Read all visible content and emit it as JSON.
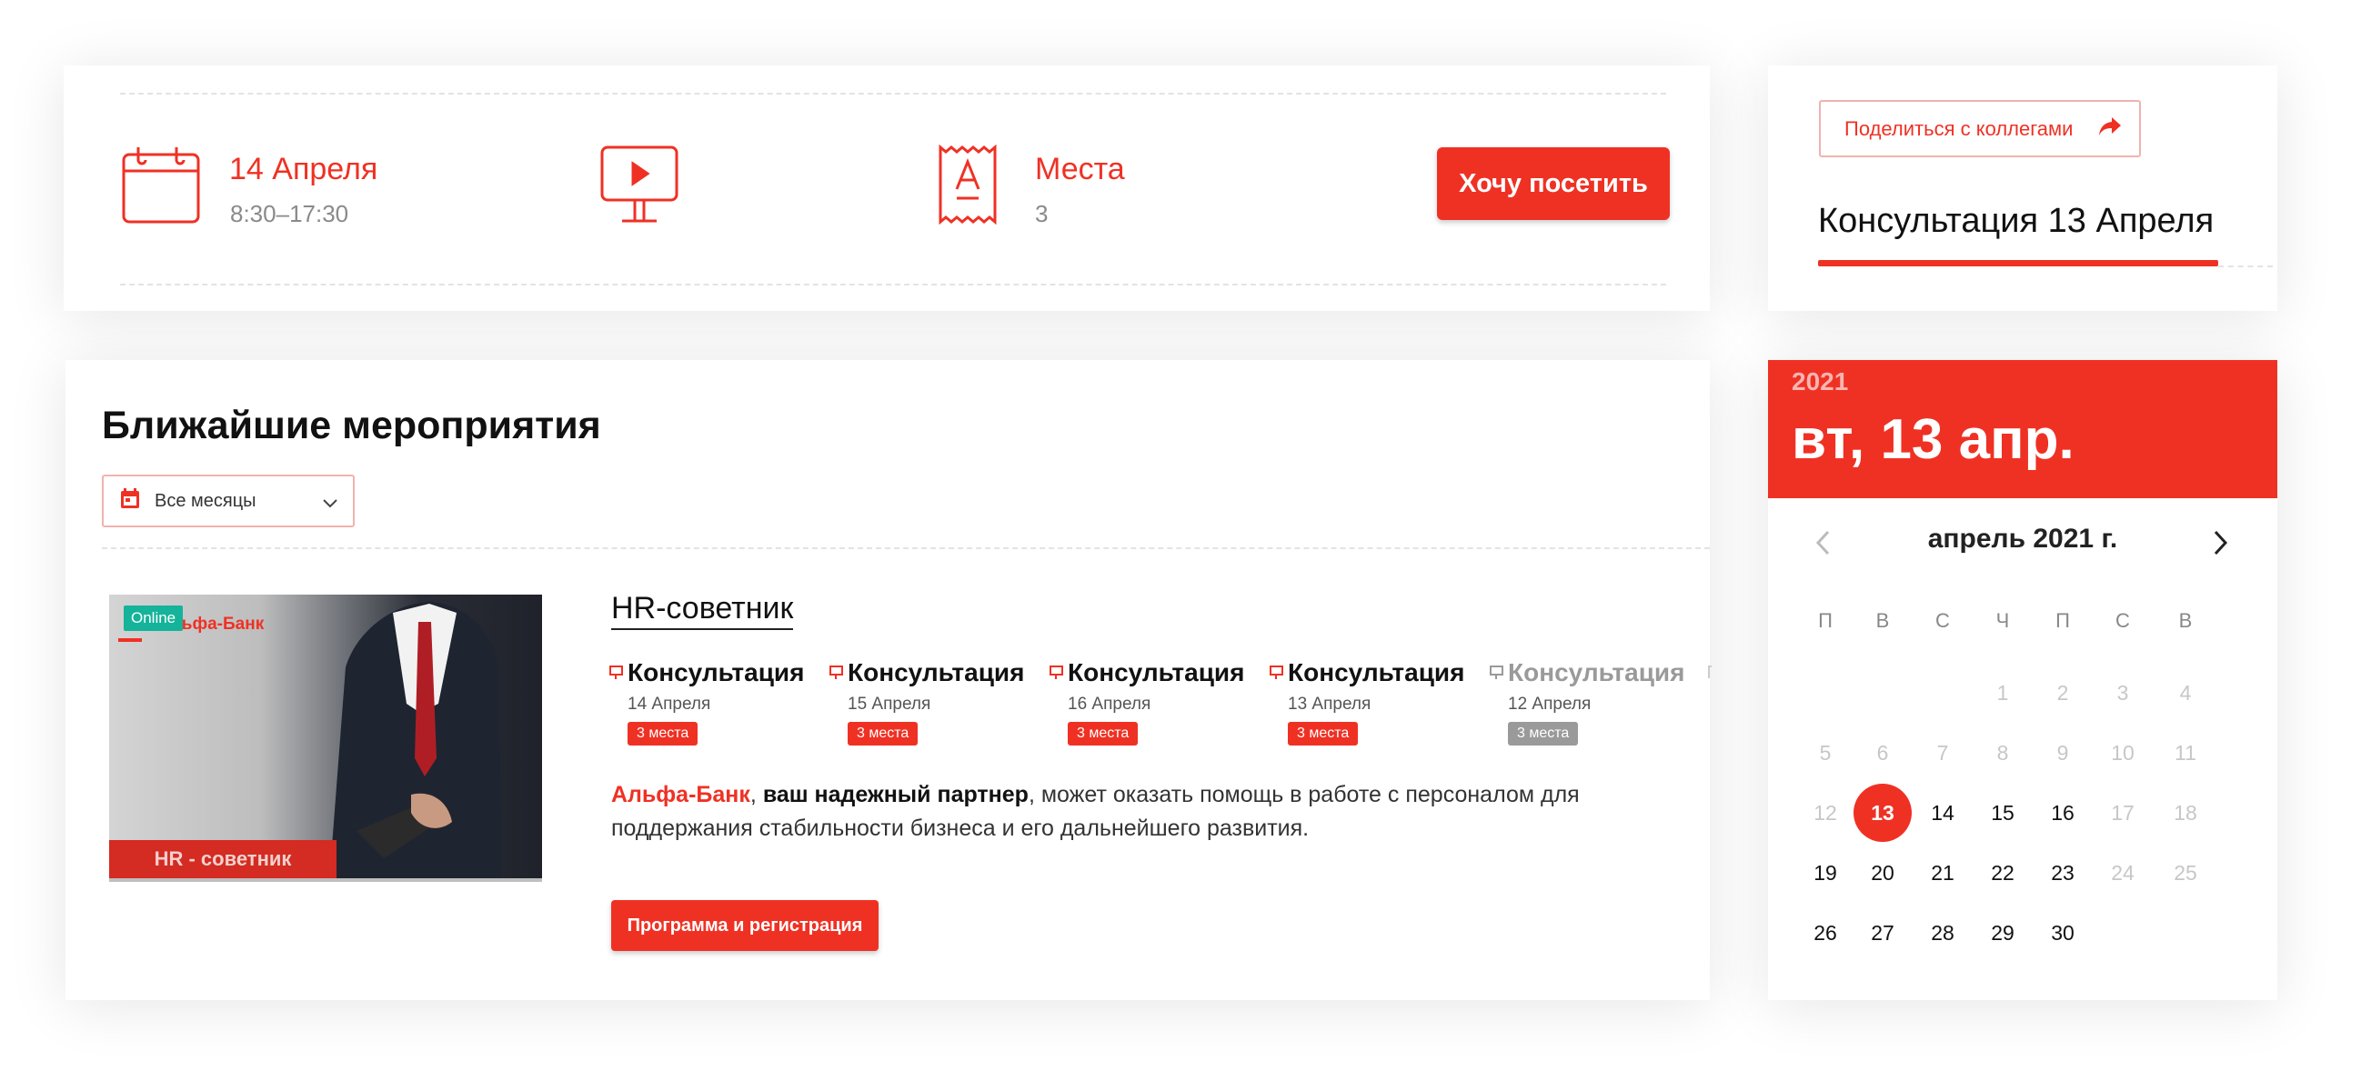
{
  "event_info": {
    "date_title": "14 Апреля",
    "time": "8:30–17:30",
    "seats_title": "Места",
    "seats_value": "3",
    "visit_button": "Хочу посетить"
  },
  "side": {
    "share_label": "Поделиться с коллегами",
    "title": "Консультация 13 Апреля"
  },
  "events": {
    "title": "Ближайшие мероприятия",
    "month_filter": "Все месяцы",
    "image": {
      "badge": "Online",
      "logo": "Альфа-Банк",
      "banner": "HR - советник"
    },
    "event_name": "HR-советник",
    "consultations": [
      {
        "title": "Консультация",
        "date": "14 Апреля",
        "badge": "3 места"
      },
      {
        "title": "Консультация",
        "date": "15 Апреля",
        "badge": "3 места"
      },
      {
        "title": "Консультация",
        "date": "16 Апреля",
        "badge": "3 места"
      },
      {
        "title": "Консультация",
        "date": "13 Апреля",
        "badge": "3 места"
      },
      {
        "title": "Консультация",
        "date": "12 Апреля",
        "badge": "3 места"
      }
    ],
    "description": {
      "brand": "Альфа-Банк",
      "comma": ", ",
      "bold": "ваш надежный партнер",
      "rest": ", может оказать помощь в работе с персоналом для поддержания стабильности бизнеса и его дальнейшего развития."
    },
    "register_button": "Программа и регистрация"
  },
  "calendar": {
    "year": "2021",
    "selected_date": "вт, 13 апр.",
    "month_label": "апрель 2021 г.",
    "weekdays": [
      "П",
      "В",
      "С",
      "Ч",
      "П",
      "С",
      "В"
    ],
    "weeks": [
      [
        "",
        "",
        "",
        "1",
        "2",
        "3",
        "4"
      ],
      [
        "5",
        "6",
        "7",
        "8",
        "9",
        "10",
        "11"
      ],
      [
        "12",
        "13",
        "14",
        "15",
        "16",
        "17",
        "18"
      ],
      [
        "19",
        "20",
        "21",
        "22",
        "23",
        "24",
        "25"
      ],
      [
        "26",
        "27",
        "28",
        "29",
        "30",
        "",
        ""
      ]
    ],
    "selected_day": "13",
    "available_days": [
      "13",
      "14",
      "15",
      "16",
      "19",
      "20",
      "21",
      "22",
      "23",
      "26",
      "27",
      "28",
      "29",
      "30"
    ]
  },
  "colors": {
    "accent": "#ef3124",
    "muted": "#9a9a9a",
    "online": "#14b39a"
  }
}
